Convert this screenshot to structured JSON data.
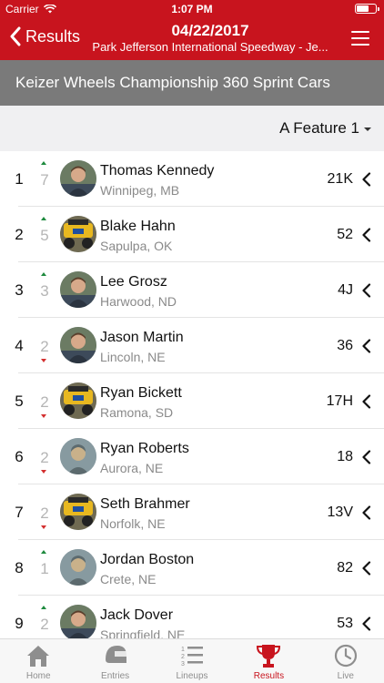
{
  "status_bar": {
    "carrier": "Carrier",
    "time": "1:07 PM",
    "battery_level": 0.65
  },
  "nav": {
    "back_label": "Results",
    "title": "04/22/2017",
    "subtitle": "Park Jefferson International Speedway - Je..."
  },
  "event": {
    "title": "Keizer Wheels Championship 360 Sprint Cars"
  },
  "feature": {
    "selected": "A Feature 1"
  },
  "colors": {
    "brand": "#c8141e",
    "up": "#1e8a3e",
    "down": "#d32f2f",
    "header_gray": "#7a7a7a"
  },
  "results": [
    {
      "pos": "1",
      "change": "7",
      "dir": "up",
      "name": "Thomas Kennedy",
      "loc": "Winnipeg, MB",
      "car": "21K",
      "avatar": "photo"
    },
    {
      "pos": "2",
      "change": "5",
      "dir": "up",
      "name": "Blake Hahn",
      "loc": "Sapulpa, OK",
      "car": "52",
      "avatar": "car"
    },
    {
      "pos": "3",
      "change": "3",
      "dir": "up",
      "name": "Lee Grosz",
      "loc": "Harwood, ND",
      "car": "4J",
      "avatar": "photo"
    },
    {
      "pos": "4",
      "change": "2",
      "dir": "down",
      "name": "Jason Martin",
      "loc": "Lincoln, NE",
      "car": "36",
      "avatar": "photo"
    },
    {
      "pos": "5",
      "change": "2",
      "dir": "down",
      "name": "Ryan Bickett",
      "loc": "Ramona, SD",
      "car": "17H",
      "avatar": "car"
    },
    {
      "pos": "6",
      "change": "2",
      "dir": "down",
      "name": "Ryan Roberts",
      "loc": "Aurora, NE",
      "car": "18",
      "avatar": "placeholder"
    },
    {
      "pos": "7",
      "change": "2",
      "dir": "down",
      "name": "Seth Brahmer",
      "loc": "Norfolk, NE",
      "car": "13V",
      "avatar": "car"
    },
    {
      "pos": "8",
      "change": "1",
      "dir": "up",
      "name": "Jordan Boston",
      "loc": "Crete, NE",
      "car": "82",
      "avatar": "placeholder"
    },
    {
      "pos": "9",
      "change": "2",
      "dir": "up",
      "name": "Jack Dover",
      "loc": "Springfield, NE",
      "car": "53",
      "avatar": "photo"
    }
  ],
  "tabs": [
    {
      "label": "Home",
      "icon": "home-icon",
      "active": false
    },
    {
      "label": "Entries",
      "icon": "helmet-icon",
      "active": false
    },
    {
      "label": "Lineups",
      "icon": "list-icon",
      "active": false
    },
    {
      "label": "Results",
      "icon": "trophy-icon",
      "active": true
    },
    {
      "label": "Live",
      "icon": "clock-icon",
      "active": false
    }
  ]
}
